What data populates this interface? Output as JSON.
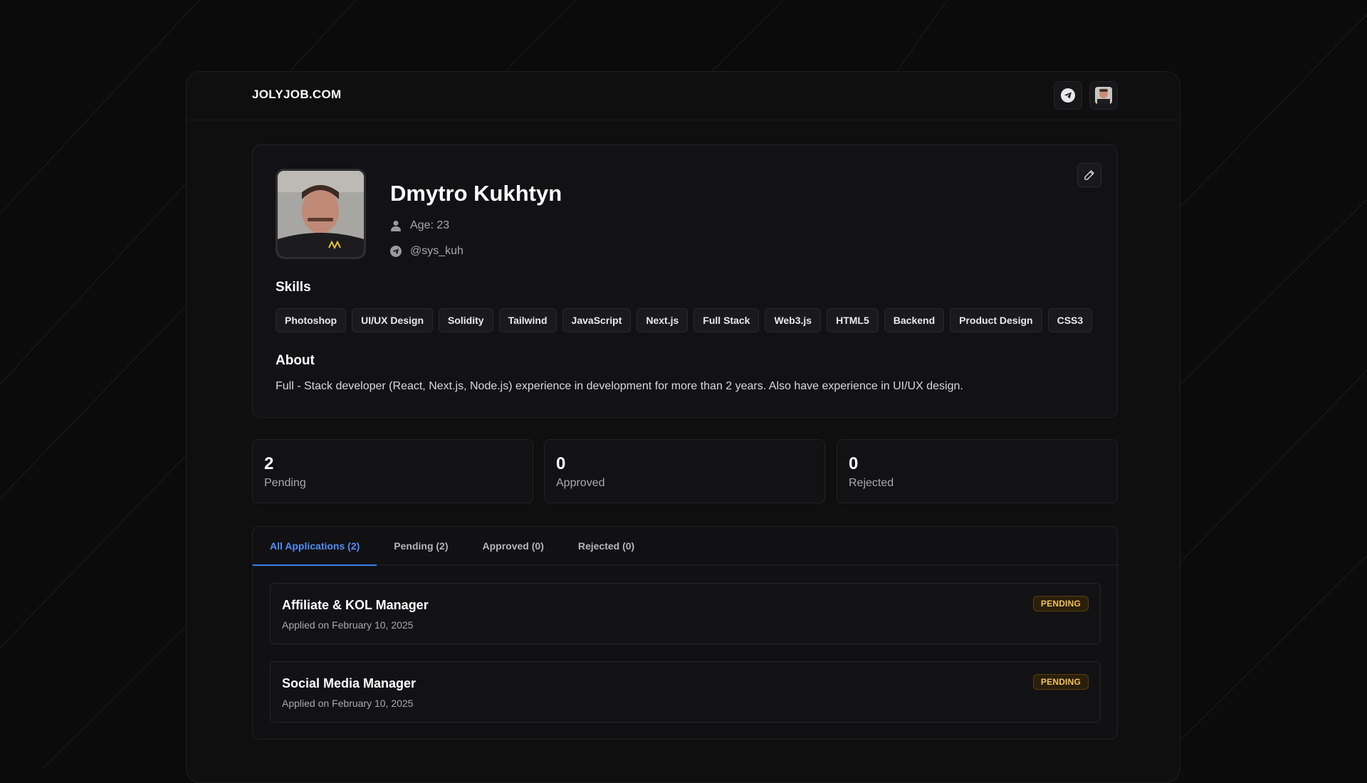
{
  "app": {
    "logo": "JOLYJOB.COM"
  },
  "header": {
    "telegram_icon": "telegram-icon",
    "avatar_icon": "user-avatar"
  },
  "profile": {
    "name": "Dmytro Kukhtyn",
    "age_label": "Age: 23",
    "telegram_handle": "@sys_kuh",
    "skills_title": "Skills",
    "skills": [
      "Photoshop",
      "UI/UX Design",
      "Solidity",
      "Tailwind",
      "JavaScript",
      "Next.js",
      "Full Stack",
      "Web3.js",
      "HTML5",
      "Backend",
      "Product Design",
      "CSS3"
    ],
    "about_title": "About",
    "about_text": "Full - Stack developer (React, Next.js, Node.js) experience in development for more than 2 years. Also have experience in UI/UX design."
  },
  "stats": [
    {
      "value": "2",
      "label": "Pending"
    },
    {
      "value": "0",
      "label": "Approved"
    },
    {
      "value": "0",
      "label": "Rejected"
    }
  ],
  "tabs": [
    {
      "label": "All Applications (2)",
      "active": true
    },
    {
      "label": "Pending (2)",
      "active": false
    },
    {
      "label": "Approved (0)",
      "active": false
    },
    {
      "label": "Rejected (0)",
      "active": false
    }
  ],
  "applications": [
    {
      "title": "Affiliate & KOL Manager",
      "date": "Applied on February 10, 2025",
      "status": "PENDING"
    },
    {
      "title": "Social Media Manager",
      "date": "Applied on February 10, 2025",
      "status": "PENDING"
    }
  ],
  "colors": {
    "background": "#0b0b0c",
    "accent": "#3b82f6",
    "pending_text": "#f3c34d",
    "pending_bg": "#2a1f0b"
  }
}
